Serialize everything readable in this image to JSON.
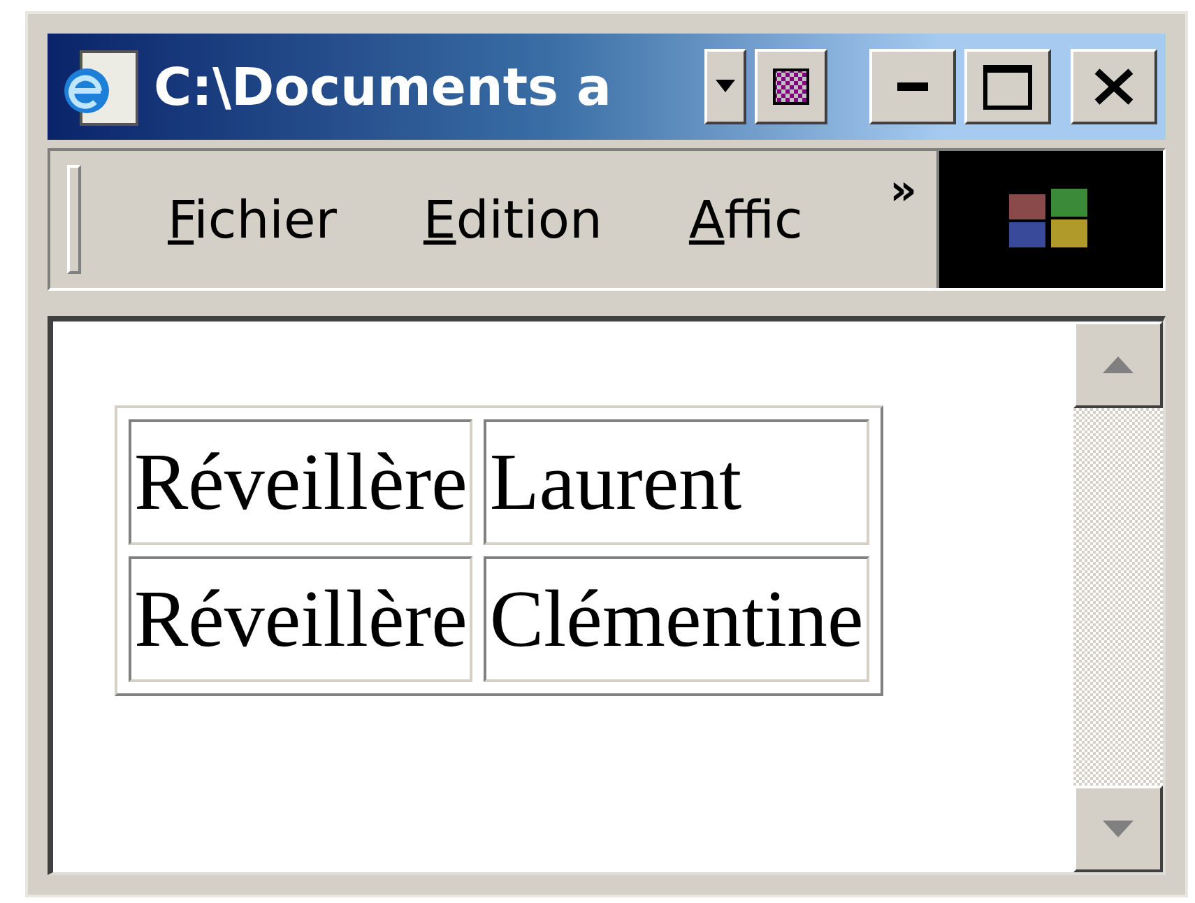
{
  "window": {
    "title": "C:\\Documents a"
  },
  "menu": {
    "items": [
      {
        "label": "Fichier"
      },
      {
        "label": "Edition"
      },
      {
        "label": "Affic"
      }
    ],
    "overflow": "»"
  },
  "table": {
    "rows": [
      [
        "Réveillère",
        "Laurent"
      ],
      [
        "Réveillère",
        "Clémentine"
      ]
    ]
  }
}
